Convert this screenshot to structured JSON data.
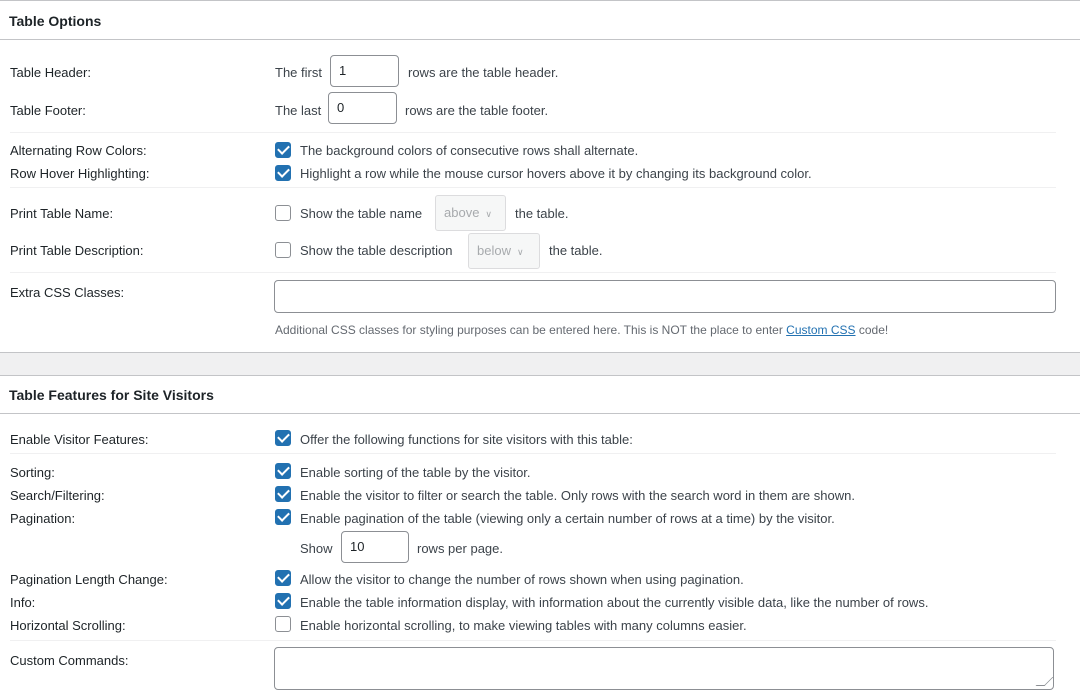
{
  "table_options": {
    "title": "Table Options",
    "header": {
      "label": "Table Header:",
      "prefix": "The first",
      "value": "1",
      "suffix": "rows are the table header."
    },
    "footer": {
      "label": "Table Footer:",
      "prefix": "The last",
      "value": "0",
      "suffix": "rows are the table footer."
    },
    "alternating": {
      "label": "Alternating Row Colors:",
      "checked": true,
      "text": "The background colors of consecutive rows shall alternate."
    },
    "hover": {
      "label": "Row Hover Highlighting:",
      "checked": true,
      "text": "Highlight a row while the mouse cursor hovers above it by changing its background color."
    },
    "print_name": {
      "label": "Print Table Name:",
      "checked": false,
      "text": "Show the table name",
      "select": "above",
      "suffix": "the table."
    },
    "print_desc": {
      "label": "Print Table Description:",
      "checked": false,
      "text": "Show the table description",
      "select": "below",
      "suffix": "the table."
    },
    "extra_css": {
      "label": "Extra CSS Classes:",
      "value": "",
      "help_before": "Additional CSS classes for styling purposes can be entered here. This is NOT the place to enter",
      "help_link": "Custom CSS",
      "help_after": "code!"
    }
  },
  "visitor_features": {
    "title": "Table Features for Site Visitors",
    "enable": {
      "label": "Enable Visitor Features:",
      "checked": true,
      "text": "Offer the following functions for site visitors with this table:"
    },
    "sorting": {
      "label": "Sorting:",
      "checked": true,
      "text": "Enable sorting of the table by the visitor."
    },
    "search": {
      "label": "Search/Filtering:",
      "checked": true,
      "text": "Enable the visitor to filter or search the table. Only rows with the search word in them are shown."
    },
    "pagination": {
      "label": "Pagination:",
      "checked": true,
      "text": "Enable pagination of the table (viewing only a certain number of rows at a time) by the visitor.",
      "show_prefix": "Show",
      "rows_value": "10",
      "rows_suffix": "rows per page."
    },
    "length_change": {
      "label": "Pagination Length Change:",
      "checked": true,
      "text": "Allow the visitor to change the number of rows shown when using pagination."
    },
    "info": {
      "label": "Info:",
      "checked": true,
      "text": "Enable the table information display, with information about the currently visible data, like the number of rows."
    },
    "hscroll": {
      "label": "Horizontal Scrolling:",
      "checked": false,
      "text": "Enable horizontal scrolling, to make viewing tables with many columns easier."
    },
    "custom_commands": {
      "label": "Custom Commands:",
      "value": ""
    }
  },
  "colors": {
    "accent": "#2271b1",
    "border": "#c3c4c7"
  }
}
